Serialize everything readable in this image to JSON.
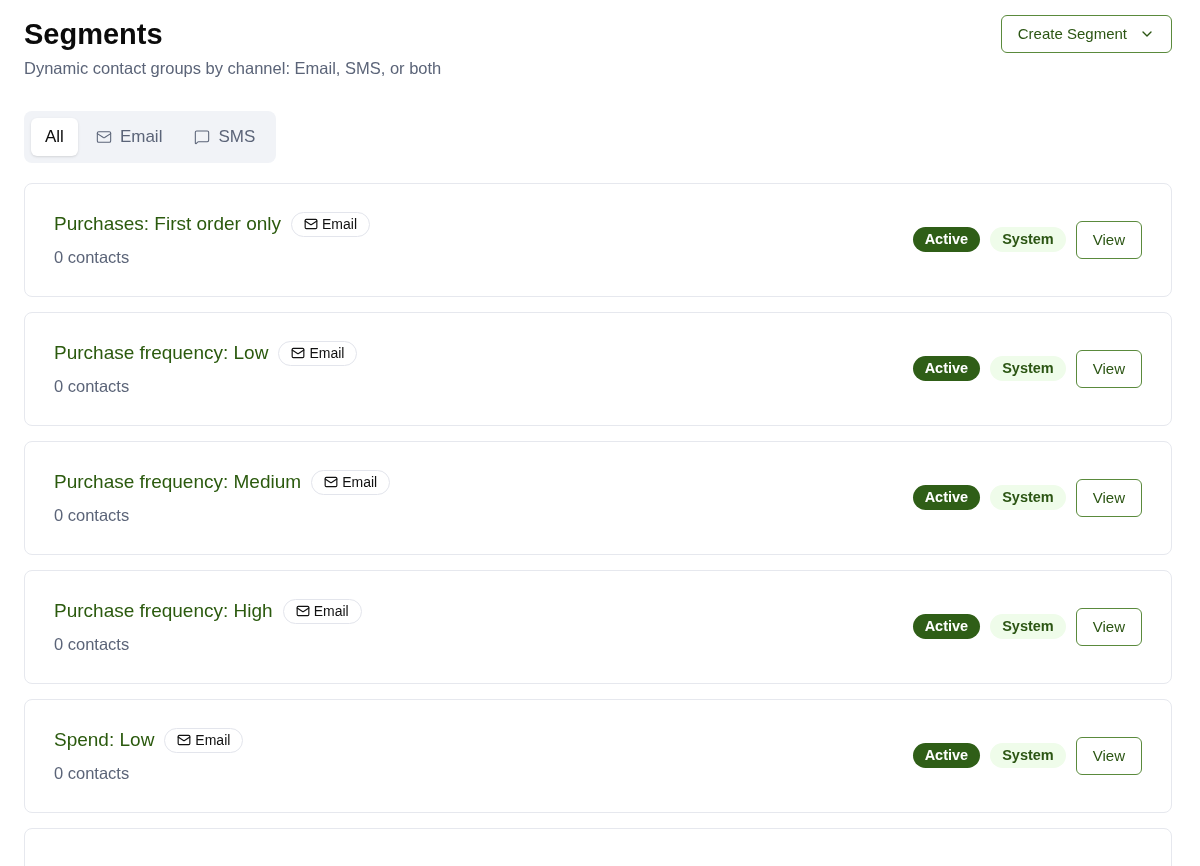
{
  "header": {
    "title": "Segments",
    "subtitle": "Dynamic contact groups by channel: Email, SMS, or both",
    "create_button": "Create Segment"
  },
  "tabs": [
    {
      "label": "All",
      "kind": "all",
      "selected": true
    },
    {
      "label": "Email",
      "kind": "email",
      "selected": false
    },
    {
      "label": "SMS",
      "kind": "sms",
      "selected": false
    }
  ],
  "segments": [
    {
      "name": "Purchases: First order only",
      "channel": {
        "label": "Email",
        "kind": "email"
      },
      "contacts": "0 contacts",
      "status": "Active",
      "type": "System",
      "action": "View"
    },
    {
      "name": "Purchase frequency: Low",
      "channel": {
        "label": "Email",
        "kind": "email"
      },
      "contacts": "0 contacts",
      "status": "Active",
      "type": "System",
      "action": "View"
    },
    {
      "name": "Purchase frequency: Medium",
      "channel": {
        "label": "Email",
        "kind": "email"
      },
      "contacts": "0 contacts",
      "status": "Active",
      "type": "System",
      "action": "View"
    },
    {
      "name": "Purchase frequency: High",
      "channel": {
        "label": "Email",
        "kind": "email"
      },
      "contacts": "0 contacts",
      "status": "Active",
      "type": "System",
      "action": "View"
    },
    {
      "name": "Spend: Low",
      "channel": {
        "label": "Email",
        "kind": "email"
      },
      "contacts": "0 contacts",
      "status": "Active",
      "type": "System",
      "action": "View"
    }
  ]
}
